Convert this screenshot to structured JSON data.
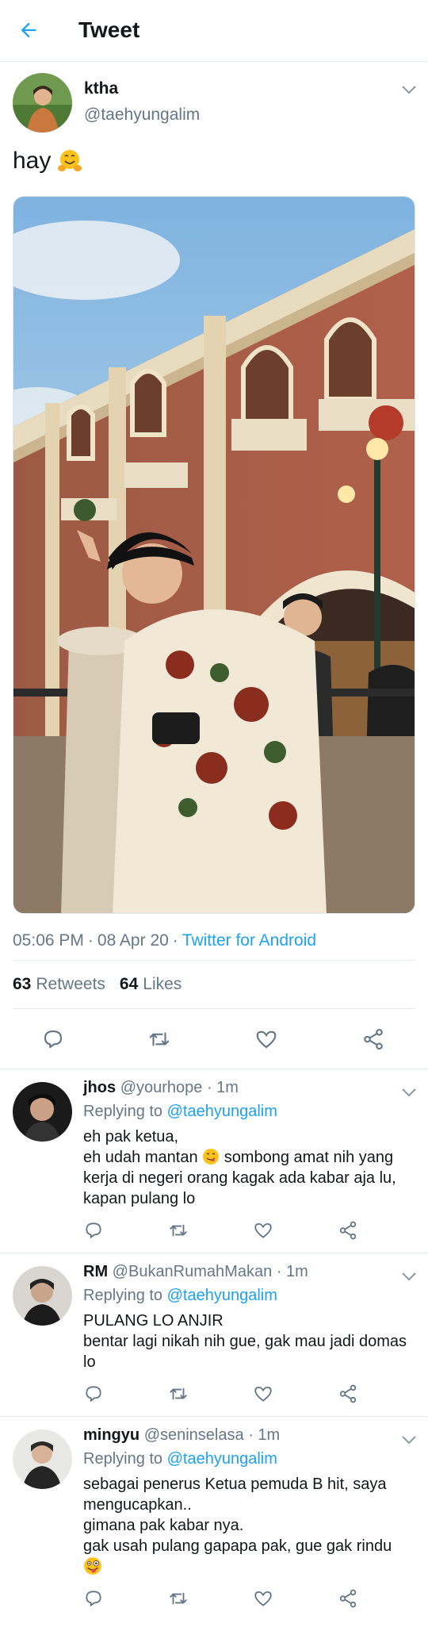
{
  "header": {
    "title": "Tweet",
    "back_icon": "arrow-left-icon"
  },
  "colors": {
    "accent": "#1da1f2",
    "secondary_text": "#657786",
    "primary_text": "#14171a",
    "divider": "#e6ecf0"
  },
  "main_tweet": {
    "name": "ktha",
    "handle": "@taehyungalim",
    "text": "hay",
    "emoji": "hugging-face-emoji",
    "time": "05:06 PM",
    "date": "08 Apr 20",
    "client": "Twitter for Android",
    "retweets": {
      "count": "63",
      "label": "Retweets"
    },
    "likes": {
      "count": "64",
      "label": "Likes"
    }
  },
  "replies": [
    {
      "name": "jhos",
      "handle": "@yourhope",
      "time": "1m",
      "replying_prefix": "Replying to",
      "replying_to": "@taehyungalim",
      "lines": [
        "eh pak ketua,",
        "eh udah mantan",
        "sombong amat nih yang kerja di negeri orang kagak ada kabar aja lu,",
        "kapan pulang lo"
      ]
    },
    {
      "name": "RM",
      "handle": "@BukanRumahMakan",
      "time": "1m",
      "replying_prefix": "Replying to",
      "replying_to": "@taehyungalim",
      "lines": [
        "PULANG LO ANJIR",
        "bentar lagi nikah nih gue, gak mau jadi domas lo"
      ]
    },
    {
      "name": "mingyu",
      "handle": "@seninselasa",
      "time": "1m",
      "replying_prefix": "Replying to",
      "replying_to": "@taehyungalim",
      "lines": [
        "sebagai penerus Ketua pemuda B hit, saya mengucapkan..",
        "gimana pak kabar nya.",
        "gak usah pulang gapapa pak, gue gak rindu"
      ]
    }
  ]
}
